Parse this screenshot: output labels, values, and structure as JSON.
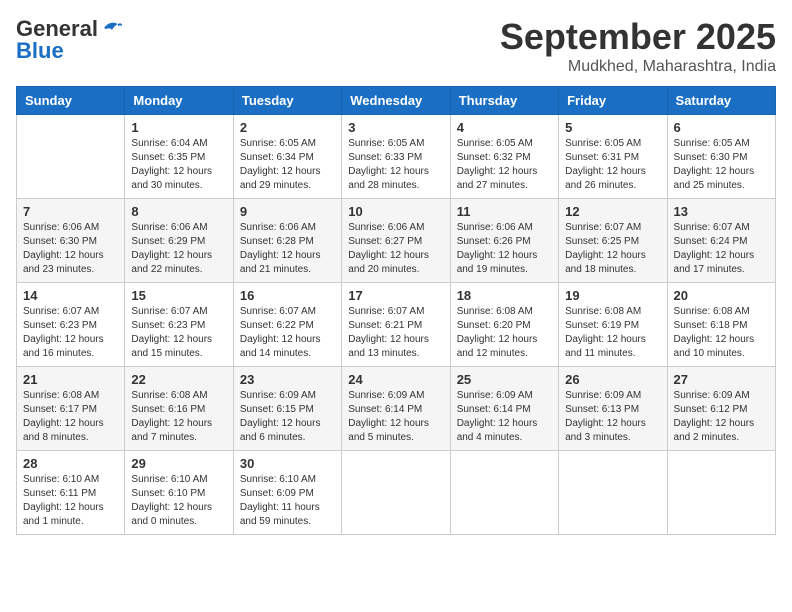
{
  "header": {
    "month": "September 2025",
    "location": "Mudkhed, Maharashtra, India",
    "logo_general": "General",
    "logo_blue": "Blue"
  },
  "columns": [
    "Sunday",
    "Monday",
    "Tuesday",
    "Wednesday",
    "Thursday",
    "Friday",
    "Saturday"
  ],
  "weeks": [
    [
      {
        "day": "",
        "info": ""
      },
      {
        "day": "1",
        "info": "Sunrise: 6:04 AM\nSunset: 6:35 PM\nDaylight: 12 hours\nand 30 minutes."
      },
      {
        "day": "2",
        "info": "Sunrise: 6:05 AM\nSunset: 6:34 PM\nDaylight: 12 hours\nand 29 minutes."
      },
      {
        "day": "3",
        "info": "Sunrise: 6:05 AM\nSunset: 6:33 PM\nDaylight: 12 hours\nand 28 minutes."
      },
      {
        "day": "4",
        "info": "Sunrise: 6:05 AM\nSunset: 6:32 PM\nDaylight: 12 hours\nand 27 minutes."
      },
      {
        "day": "5",
        "info": "Sunrise: 6:05 AM\nSunset: 6:31 PM\nDaylight: 12 hours\nand 26 minutes."
      },
      {
        "day": "6",
        "info": "Sunrise: 6:05 AM\nSunset: 6:30 PM\nDaylight: 12 hours\nand 25 minutes."
      }
    ],
    [
      {
        "day": "7",
        "info": "Sunrise: 6:06 AM\nSunset: 6:30 PM\nDaylight: 12 hours\nand 23 minutes."
      },
      {
        "day": "8",
        "info": "Sunrise: 6:06 AM\nSunset: 6:29 PM\nDaylight: 12 hours\nand 22 minutes."
      },
      {
        "day": "9",
        "info": "Sunrise: 6:06 AM\nSunset: 6:28 PM\nDaylight: 12 hours\nand 21 minutes."
      },
      {
        "day": "10",
        "info": "Sunrise: 6:06 AM\nSunset: 6:27 PM\nDaylight: 12 hours\nand 20 minutes."
      },
      {
        "day": "11",
        "info": "Sunrise: 6:06 AM\nSunset: 6:26 PM\nDaylight: 12 hours\nand 19 minutes."
      },
      {
        "day": "12",
        "info": "Sunrise: 6:07 AM\nSunset: 6:25 PM\nDaylight: 12 hours\nand 18 minutes."
      },
      {
        "day": "13",
        "info": "Sunrise: 6:07 AM\nSunset: 6:24 PM\nDaylight: 12 hours\nand 17 minutes."
      }
    ],
    [
      {
        "day": "14",
        "info": "Sunrise: 6:07 AM\nSunset: 6:23 PM\nDaylight: 12 hours\nand 16 minutes."
      },
      {
        "day": "15",
        "info": "Sunrise: 6:07 AM\nSunset: 6:23 PM\nDaylight: 12 hours\nand 15 minutes."
      },
      {
        "day": "16",
        "info": "Sunrise: 6:07 AM\nSunset: 6:22 PM\nDaylight: 12 hours\nand 14 minutes."
      },
      {
        "day": "17",
        "info": "Sunrise: 6:07 AM\nSunset: 6:21 PM\nDaylight: 12 hours\nand 13 minutes."
      },
      {
        "day": "18",
        "info": "Sunrise: 6:08 AM\nSunset: 6:20 PM\nDaylight: 12 hours\nand 12 minutes."
      },
      {
        "day": "19",
        "info": "Sunrise: 6:08 AM\nSunset: 6:19 PM\nDaylight: 12 hours\nand 11 minutes."
      },
      {
        "day": "20",
        "info": "Sunrise: 6:08 AM\nSunset: 6:18 PM\nDaylight: 12 hours\nand 10 minutes."
      }
    ],
    [
      {
        "day": "21",
        "info": "Sunrise: 6:08 AM\nSunset: 6:17 PM\nDaylight: 12 hours\nand 8 minutes."
      },
      {
        "day": "22",
        "info": "Sunrise: 6:08 AM\nSunset: 6:16 PM\nDaylight: 12 hours\nand 7 minutes."
      },
      {
        "day": "23",
        "info": "Sunrise: 6:09 AM\nSunset: 6:15 PM\nDaylight: 12 hours\nand 6 minutes."
      },
      {
        "day": "24",
        "info": "Sunrise: 6:09 AM\nSunset: 6:14 PM\nDaylight: 12 hours\nand 5 minutes."
      },
      {
        "day": "25",
        "info": "Sunrise: 6:09 AM\nSunset: 6:14 PM\nDaylight: 12 hours\nand 4 minutes."
      },
      {
        "day": "26",
        "info": "Sunrise: 6:09 AM\nSunset: 6:13 PM\nDaylight: 12 hours\nand 3 minutes."
      },
      {
        "day": "27",
        "info": "Sunrise: 6:09 AM\nSunset: 6:12 PM\nDaylight: 12 hours\nand 2 minutes."
      }
    ],
    [
      {
        "day": "28",
        "info": "Sunrise: 6:10 AM\nSunset: 6:11 PM\nDaylight: 12 hours\nand 1 minute."
      },
      {
        "day": "29",
        "info": "Sunrise: 6:10 AM\nSunset: 6:10 PM\nDaylight: 12 hours\nand 0 minutes."
      },
      {
        "day": "30",
        "info": "Sunrise: 6:10 AM\nSunset: 6:09 PM\nDaylight: 11 hours\nand 59 minutes."
      },
      {
        "day": "",
        "info": ""
      },
      {
        "day": "",
        "info": ""
      },
      {
        "day": "",
        "info": ""
      },
      {
        "day": "",
        "info": ""
      }
    ]
  ]
}
